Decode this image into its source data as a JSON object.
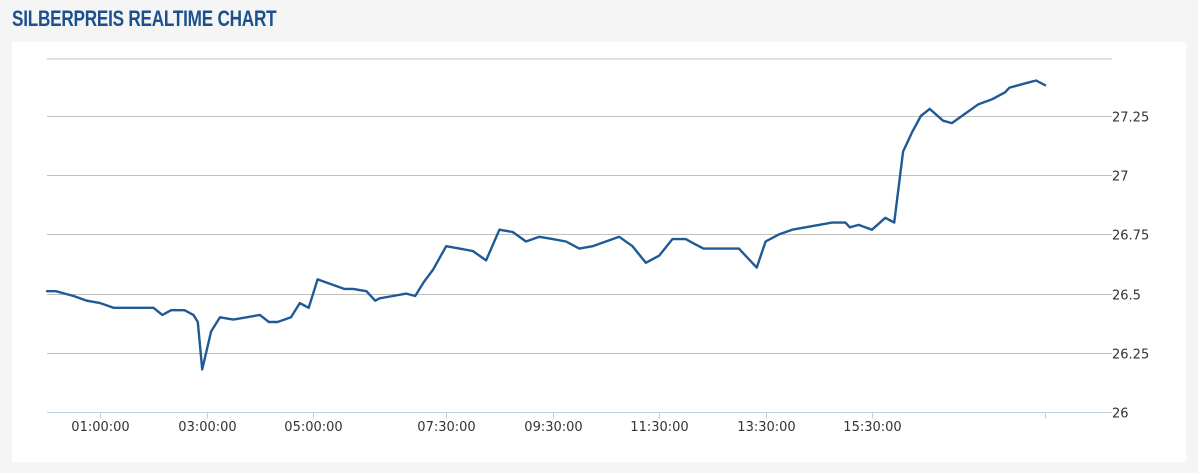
{
  "page": {
    "title": "SILBERPREIS REALTIME CHART",
    "title_color": "#1b4f8e"
  },
  "chart_data": {
    "type": "line",
    "xlabel": "",
    "ylabel": "",
    "grid": true,
    "y_axis_side": "right",
    "ylim": [
      26.0,
      27.5
    ],
    "y_ticks": [
      26.0,
      26.25,
      26.5,
      26.75,
      27.0,
      27.25
    ],
    "y_tick_labels": [
      "26",
      "26.25",
      "26.5",
      "26.75",
      "27",
      "27.25"
    ],
    "x_range": [
      "00:00",
      "18:45"
    ],
    "x_ticks": [
      "01:00",
      "03:00",
      "05:00",
      "07:30",
      "09:30",
      "11:30",
      "13:30",
      "15:30"
    ],
    "x_tick_labels": [
      "01:00:00",
      "03:00:00",
      "05:00:00",
      "07:30:00",
      "09:30:00",
      "11:30:00",
      "13:30:00",
      "15:30:00"
    ],
    "line_color": "#1f5a96",
    "grid_color": "#c0c0c0",
    "series": [
      {
        "x": [
          "00:00",
          "00:10",
          "00:20",
          "00:30",
          "00:45",
          "01:00",
          "01:15",
          "01:30",
          "01:45",
          "02:00",
          "02:10",
          "02:20",
          "02:35",
          "02:45",
          "02:50",
          "02:55",
          "03:05",
          "03:15",
          "03:30",
          "03:45",
          "04:00",
          "04:10",
          "04:20",
          "04:35",
          "04:45",
          "04:55",
          "05:05",
          "05:20",
          "05:35",
          "05:45",
          "06:00",
          "06:10",
          "06:15",
          "06:30",
          "06:45",
          "06:55",
          "07:05",
          "07:15",
          "07:30",
          "07:45",
          "08:00",
          "08:15",
          "08:30",
          "08:45",
          "09:00",
          "09:15",
          "09:30",
          "09:45",
          "10:00",
          "10:15",
          "10:30",
          "10:45",
          "11:00",
          "11:15",
          "11:30",
          "11:45",
          "12:00",
          "12:10",
          "12:20",
          "12:40",
          "13:00",
          "13:20",
          "13:30",
          "13:45",
          "14:00",
          "14:15",
          "14:30",
          "14:45",
          "15:00",
          "15:05",
          "15:15",
          "15:30",
          "15:45",
          "15:55",
          "16:05",
          "16:15",
          "16:25",
          "16:35",
          "16:50",
          "17:00",
          "17:15",
          "17:30",
          "17:45",
          "17:55",
          "18:00",
          "18:05",
          "18:15",
          "18:25",
          "18:35",
          "18:45"
        ],
        "y": [
          26.51,
          26.51,
          26.5,
          26.49,
          26.47,
          26.46,
          26.44,
          26.44,
          26.44,
          26.44,
          26.41,
          26.43,
          26.43,
          26.41,
          26.38,
          26.18,
          26.34,
          26.4,
          26.39,
          26.4,
          26.41,
          26.38,
          26.38,
          26.4,
          26.46,
          26.44,
          26.56,
          26.54,
          26.52,
          26.52,
          26.51,
          26.47,
          26.48,
          26.49,
          26.5,
          26.49,
          26.55,
          26.6,
          26.7,
          26.69,
          26.68,
          26.64,
          26.77,
          26.76,
          26.72,
          26.74,
          26.73,
          26.72,
          26.69,
          26.7,
          26.72,
          26.74,
          26.7,
          26.63,
          26.66,
          26.73,
          26.73,
          26.71,
          26.69,
          26.69,
          26.69,
          26.61,
          26.72,
          26.75,
          26.77,
          26.78,
          26.79,
          26.8,
          26.8,
          26.78,
          26.79,
          26.77,
          26.82,
          26.8,
          27.1,
          27.18,
          27.25,
          27.28,
          27.23,
          27.22,
          27.26,
          27.3,
          27.32,
          27.34,
          27.35,
          27.37,
          27.38,
          27.39,
          27.4,
          27.38
        ]
      }
    ]
  }
}
